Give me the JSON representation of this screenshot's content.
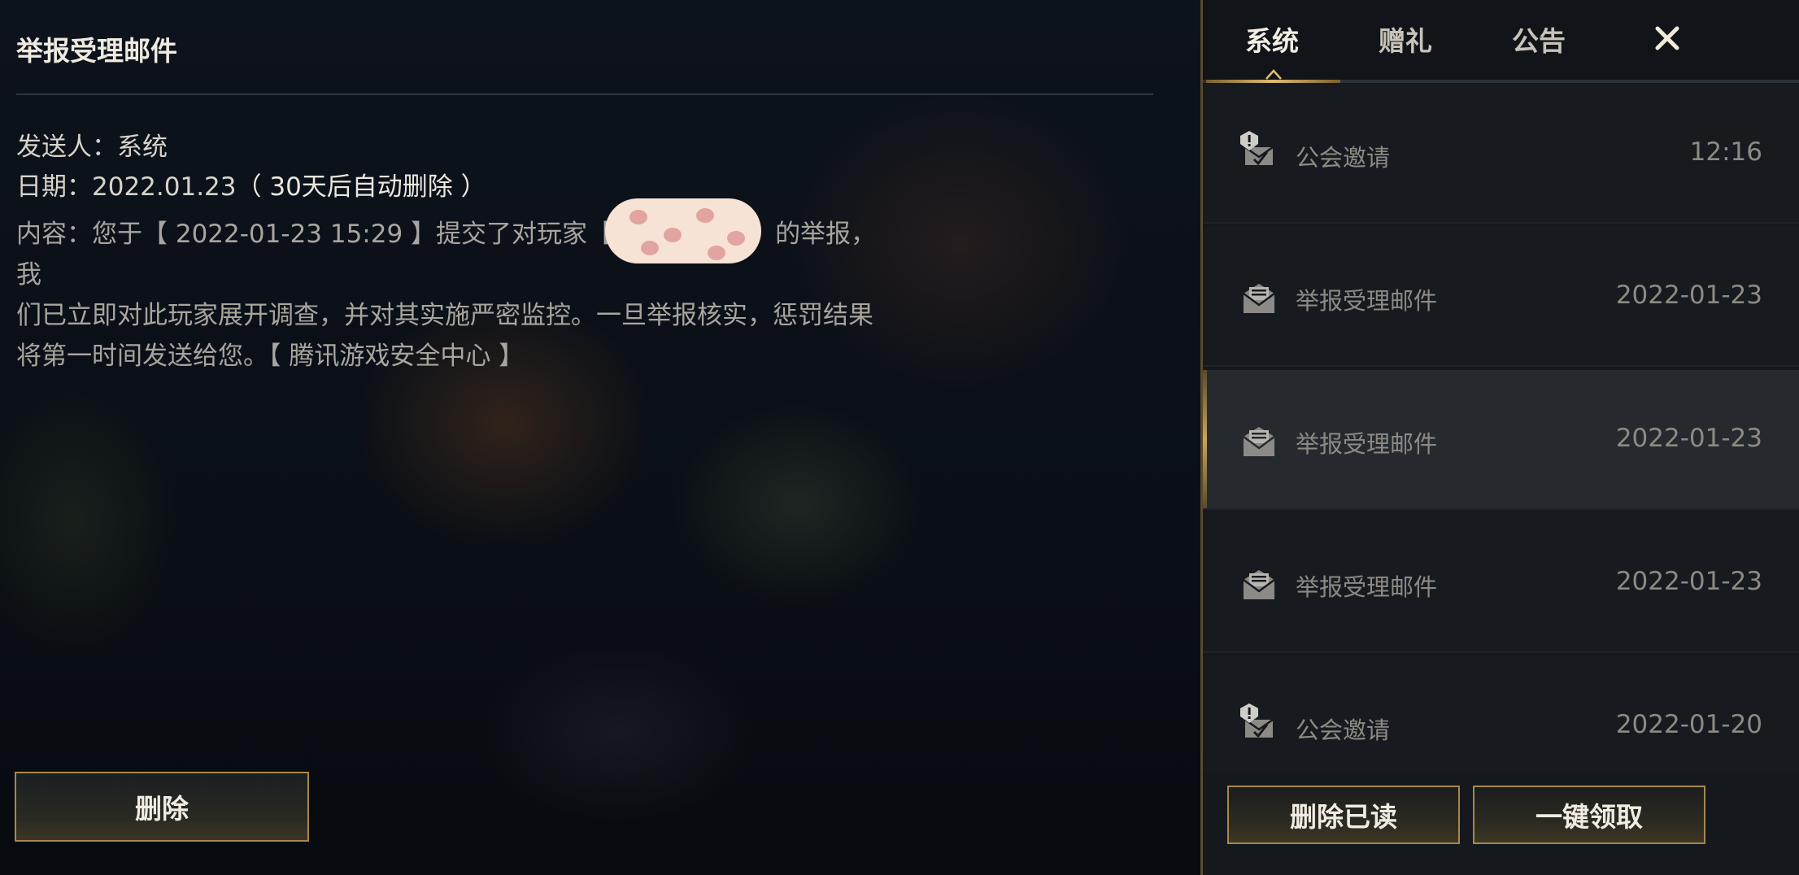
{
  "detail": {
    "title": "举报受理邮件",
    "sender_label": "发送人：",
    "sender_value": "系统",
    "date_label": "日期：",
    "date_value": "2022.01.23",
    "date_note": "（ 30天后自动删除 ）",
    "content_line1": "内容：您于【 2022-01-23 15:29 】提交了对玩家【",
    "content_line1_tail": "的举报，我",
    "content_line2": "们已立即对此玩家展开调查，并对其实施严密监控。一旦举报核实，惩罚结果",
    "content_line3": "将第一时间发送给您。【 腾讯游戏安全中心 】",
    "delete_button": "删除"
  },
  "tabs": [
    {
      "label": "系统",
      "active": true
    },
    {
      "label": "赠礼",
      "active": false
    },
    {
      "label": "公告",
      "active": false
    }
  ],
  "close_icon": "close-icon",
  "mails": [
    {
      "icon": "guild-invite-icon",
      "subject": "公会邀请",
      "date": "12:16",
      "selected": false
    },
    {
      "icon": "mail-icon",
      "subject": "举报受理邮件",
      "date": "2022-01-23",
      "selected": false
    },
    {
      "icon": "mail-icon",
      "subject": "举报受理邮件",
      "date": "2022-01-23",
      "selected": true
    },
    {
      "icon": "mail-icon",
      "subject": "举报受理邮件",
      "date": "2022-01-23",
      "selected": false
    },
    {
      "icon": "guild-invite-icon",
      "subject": "公会邀请",
      "date": "2022-01-20",
      "selected": false
    }
  ],
  "actions": {
    "delete_read": "删除已读",
    "claim_all": "一键领取"
  },
  "colors": {
    "accent_gold": "#c9a45c",
    "panel_bg": "#15191e"
  }
}
